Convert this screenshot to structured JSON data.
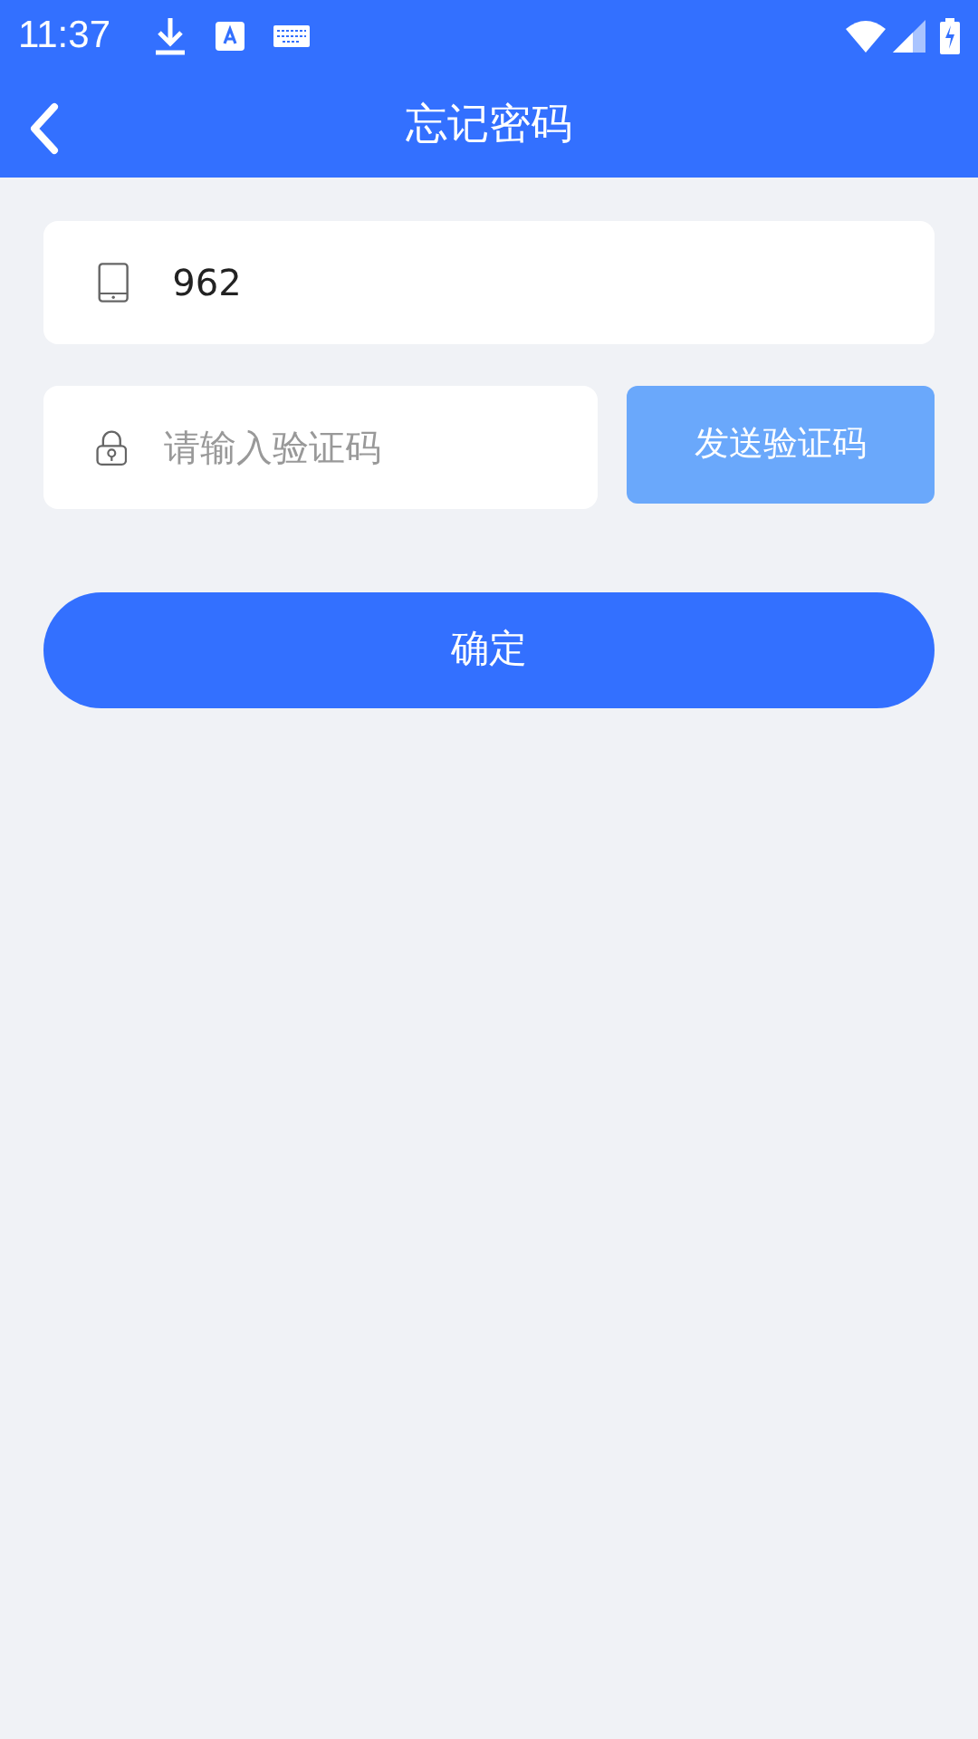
{
  "status_bar": {
    "time": "11:37"
  },
  "header": {
    "title": "忘记密码"
  },
  "phone_field": {
    "value": "962"
  },
  "code_field": {
    "placeholder": "请输入验证码"
  },
  "send_code_button": {
    "label": "发送验证码",
    "disabled": true
  },
  "confirm_button": {
    "label": "确定"
  }
}
